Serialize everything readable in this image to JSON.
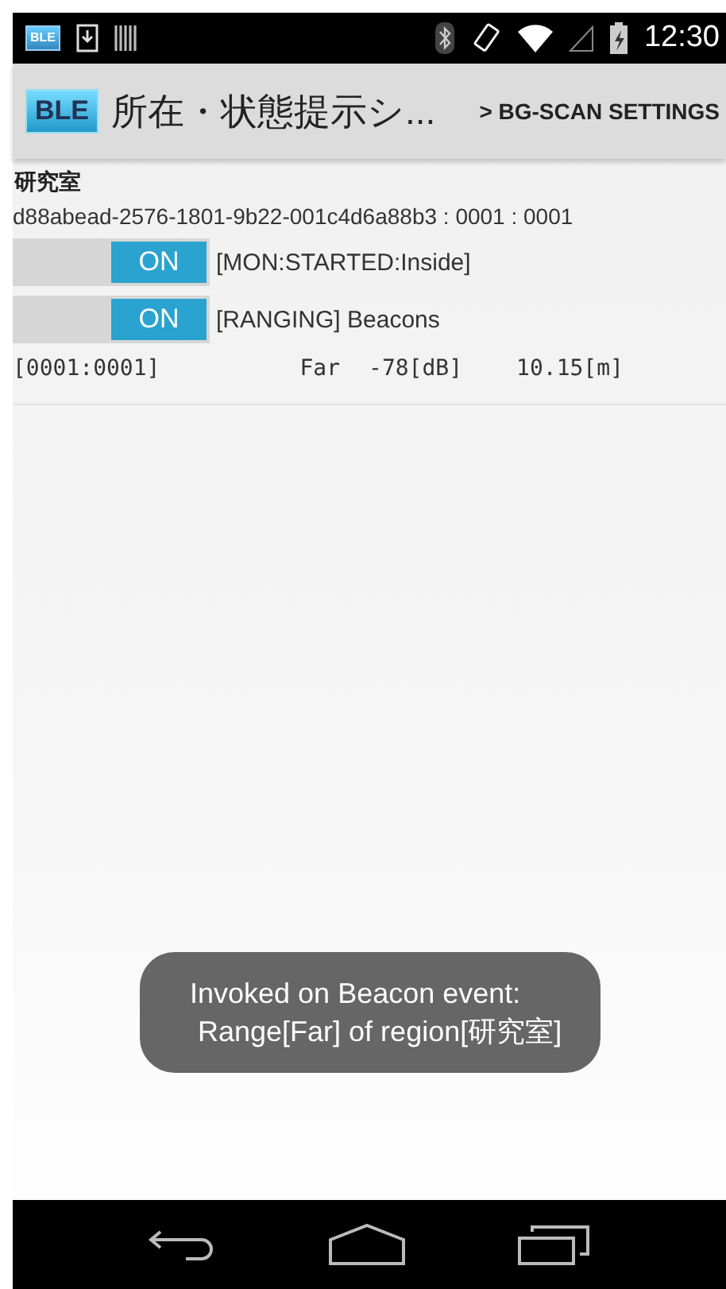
{
  "status_bar": {
    "time": "12:30",
    "notification_icon_label": "BLE"
  },
  "action_bar": {
    "logo_label": "BLE",
    "title": "所在・状態提示シ...",
    "action": "> BG-SCAN SETTINGS"
  },
  "region": {
    "name": "研究室",
    "identifier": "d88abead-2576-1801-9b22-001c4d6a88b3 : 0001 : 0001",
    "switches": [
      {
        "label": "ON",
        "on": true,
        "status": "[MON:STARTED:Inside]"
      },
      {
        "label": "ON",
        "on": true,
        "status": "[RANGING] Beacons"
      }
    ],
    "beacons": [
      {
        "id": "[0001:0001]",
        "proximity": "Far",
        "rssi": "-78[dB]",
        "distance": "10.15[m]"
      }
    ]
  },
  "toast": {
    "lines": [
      "Invoked on Beacon event:",
      " Range[Far] of region[研究室]"
    ]
  }
}
